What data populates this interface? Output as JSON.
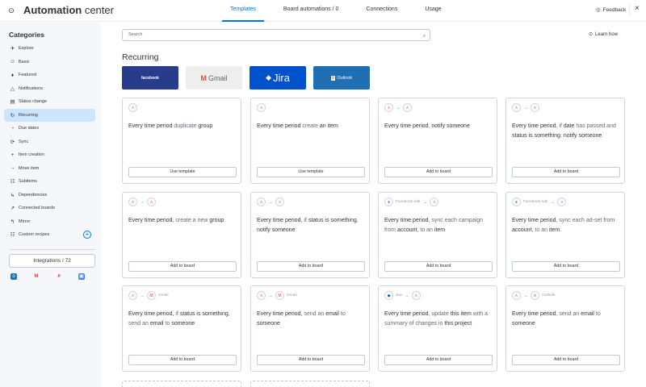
{
  "header": {
    "title_bold": "Automation",
    "title_rest": " center",
    "tabs": [
      "Templates",
      "Board automations / 0",
      "Connections",
      "Usage"
    ],
    "feedback": "Feedback",
    "close": "×"
  },
  "sidebar": {
    "title": "Categories",
    "items": [
      {
        "label": "Explore",
        "icon": "✈"
      },
      {
        "label": "Basic",
        "icon": "☺"
      },
      {
        "label": "Featured",
        "icon": "♦"
      },
      {
        "label": "Notifications",
        "icon": "△"
      },
      {
        "label": "Status change",
        "icon": "▤"
      },
      {
        "label": "Recurring",
        "icon": "↻"
      },
      {
        "label": "Due dates",
        "icon": "◔"
      },
      {
        "label": "Sync",
        "icon": "⟳"
      },
      {
        "label": "Item creation",
        "icon": "+"
      },
      {
        "label": "Move item",
        "icon": "→"
      },
      {
        "label": "Subitems",
        "icon": "☷"
      },
      {
        "label": "Dependencies",
        "icon": "↳"
      },
      {
        "label": "Connected boards",
        "icon": "↗"
      },
      {
        "label": "Mirror",
        "icon": "↰"
      },
      {
        "label": "Custom recipes",
        "icon": "☷"
      }
    ],
    "integrations": "Integrations / 72"
  },
  "main": {
    "search_placeholder": "Search",
    "learn_how": "Learn how",
    "section_title": "Recurring",
    "logos": {
      "facebook": "facebook",
      "gmail": "Gmail",
      "jira": "Jira",
      "outlook": "Outlook"
    },
    "cards": [
      {
        "src": "",
        "dst": "",
        "parts": [
          [
            "Every time period",
            0
          ],
          [
            " duplicate ",
            1
          ],
          [
            "group",
            0
          ]
        ],
        "button": "Use template"
      },
      {
        "src": "",
        "dst": "",
        "parts": [
          [
            "Every time period",
            0
          ],
          [
            " create ",
            1
          ],
          [
            "an item",
            0
          ]
        ],
        "button": "Use template"
      },
      {
        "src": "",
        "dst": "",
        "parts": [
          [
            "Every time period",
            0
          ],
          [
            ", ",
            1
          ],
          [
            "notify someone",
            0
          ]
        ],
        "button": "Add to board"
      },
      {
        "src": "",
        "dst": "",
        "parts": [
          [
            "Every time period",
            0
          ],
          [
            ", if ",
            1
          ],
          [
            "date",
            0
          ],
          [
            " has passed and ",
            1
          ],
          [
            "status is something",
            0
          ],
          [
            ", ",
            1
          ],
          [
            "notify someone",
            0
          ]
        ],
        "button": "Add to board"
      },
      {
        "src": "",
        "dst": "",
        "parts": [
          [
            "Every time period",
            0
          ],
          [
            ", create a new ",
            1
          ],
          [
            "group",
            0
          ]
        ],
        "button": "Add to board"
      },
      {
        "src": "",
        "dst": "",
        "parts": [
          [
            "Every time period",
            0
          ],
          [
            ", if ",
            1
          ],
          [
            "status is something",
            0
          ],
          [
            ", ",
            1
          ],
          [
            "notify someone",
            0
          ]
        ],
        "button": "Add to board"
      },
      {
        "src": "Facebook Ads",
        "dst": "",
        "parts": [
          [
            "Every time period",
            0
          ],
          [
            ", sync each campaign from ",
            1
          ],
          [
            "account",
            0
          ],
          [
            ", to an ",
            1
          ],
          [
            "item",
            0
          ]
        ],
        "button": "Add to board"
      },
      {
        "src": "Facebook Ads",
        "dst": "",
        "parts": [
          [
            "Every time period",
            0
          ],
          [
            ", sync each ad-set from ",
            1
          ],
          [
            "account",
            0
          ],
          [
            ", to an ",
            1
          ],
          [
            "item",
            0
          ],
          [
            ".",
            1
          ]
        ],
        "button": "Add to board"
      },
      {
        "src": "",
        "dst": "Gmail",
        "parts": [
          [
            "Every time period",
            0
          ],
          [
            ", if ",
            1
          ],
          [
            "status is something",
            0
          ],
          [
            ", send an ",
            1
          ],
          [
            "email",
            0
          ],
          [
            " to ",
            1
          ],
          [
            "someone",
            0
          ]
        ],
        "button": "Add to board"
      },
      {
        "src": "",
        "dst": "Gmail",
        "parts": [
          [
            "Every time period",
            0
          ],
          [
            ", send an ",
            1
          ],
          [
            "email",
            0
          ],
          [
            " to ",
            1
          ],
          [
            "someone",
            0
          ]
        ],
        "button": "Add to board"
      },
      {
        "src": "Jira",
        "dst": "",
        "parts": [
          [
            "Every time period",
            0
          ],
          [
            ", update ",
            1
          ],
          [
            "this item",
            0
          ],
          [
            " with a summary of changes in ",
            1
          ],
          [
            "this project",
            0
          ]
        ],
        "button": "Add to board"
      },
      {
        "src": "",
        "dst": "Outlook",
        "parts": [
          [
            "Every time period",
            0
          ],
          [
            ", send an ",
            1
          ],
          [
            "email",
            0
          ],
          [
            " to ",
            1
          ],
          [
            "someone",
            0
          ]
        ],
        "button": "Add to board"
      }
    ]
  },
  "colors": {
    "accent": "#0073ea",
    "active_bg": "#cce5ff",
    "sidebar_bg": "#f6f7fb"
  }
}
